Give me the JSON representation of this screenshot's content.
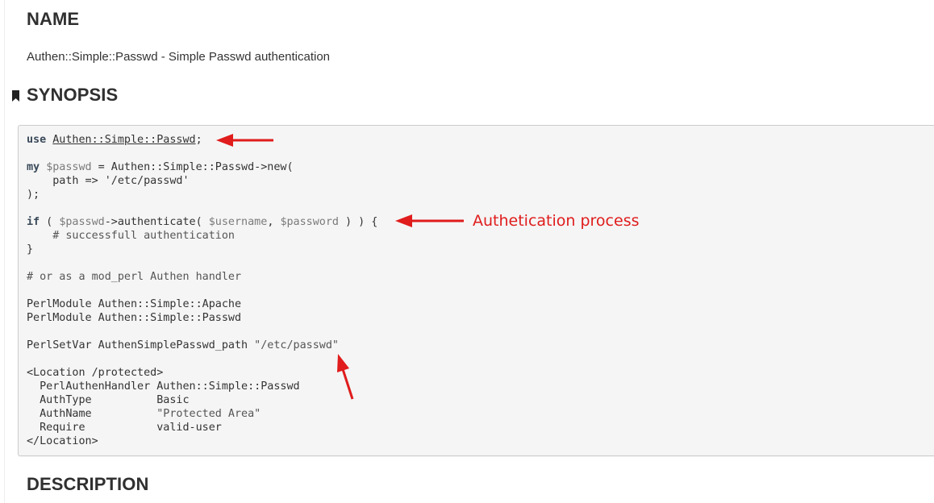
{
  "sections": {
    "name_heading": "NAME",
    "name_summary": "Authen::Simple::Passwd - Simple Passwd authentication",
    "synopsis_heading": "SYNOPSIS",
    "description_heading": "DESCRIPTION"
  },
  "code": {
    "line1_kw": "use",
    "line1_module": "Authen::Simple::Passwd",
    "line1_end": ";",
    "line2_kw": "my",
    "line2_var": "$passwd",
    "line2_rest": " = Authen::Simple::Passwd->new(",
    "line3": "    path => '/etc/passwd'",
    "line4": ");",
    "line5_kw": "if",
    "line5_a": " ( ",
    "line5_var1": "$passwd",
    "line5_b": "->authenticate( ",
    "line5_var2": "$username",
    "line5_c": ", ",
    "line5_var3": "$password",
    "line5_d": " ) ) {",
    "line6": "    # successfull authentication",
    "line7": "}",
    "line8": "# or as a mod_perl Authen handler",
    "line9": "PerlModule Authen::Simple::Apache",
    "line10": "PerlModule Authen::Simple::Passwd",
    "line11_a": "PerlSetVar AuthenSimplePasswd_path ",
    "line11_str": "\"/etc/passwd\"",
    "line12": "<Location /protected>",
    "line13": "  PerlAuthenHandler Authen::Simple::Passwd",
    "line14": "  AuthType          Basic",
    "line15_a": "  AuthName          ",
    "line15_str": "\"Protected Area\"",
    "line16": "  Require           valid-user",
    "line17": "</Location>"
  },
  "annotations": {
    "auth_label": "Authetication process",
    "color": "#e01c1c"
  },
  "icons": {
    "bookmark": "bookmark-icon"
  }
}
